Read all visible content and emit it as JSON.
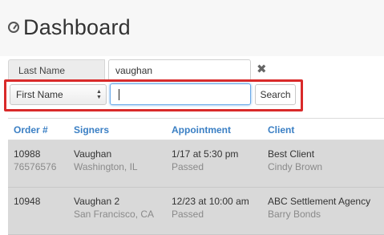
{
  "header": {
    "title": "Dashboard",
    "icon": "dashboard-icon"
  },
  "filters": {
    "last_name_label": "Last Name",
    "last_name_value": "vaughan",
    "clear_icon": "close-icon",
    "field_select_value": "First Name",
    "search_value": "",
    "search_button_label": "Search",
    "highlight_color": "#d92a2a"
  },
  "table": {
    "headers": [
      "Order #",
      "Signers",
      "Appointment",
      "Client"
    ],
    "header_color": "#3a7fc4",
    "rows": [
      {
        "order": "10988",
        "order_sub": "76576576",
        "signer": "Vaughan",
        "signer_sub": "Washington, IL",
        "appointment": "1/17 at 5:30 pm",
        "appointment_sub": "Passed",
        "client": "Best Client",
        "client_sub": "Cindy Brown"
      },
      {
        "order": "10948",
        "order_sub": "",
        "signer": "Vaughan 2",
        "signer_sub": "San Francisco, CA",
        "appointment": "12/23 at 10:00 am",
        "appointment_sub": "Passed",
        "client": "ABC Settlement Agency",
        "client_sub": "Barry Bonds"
      }
    ]
  }
}
